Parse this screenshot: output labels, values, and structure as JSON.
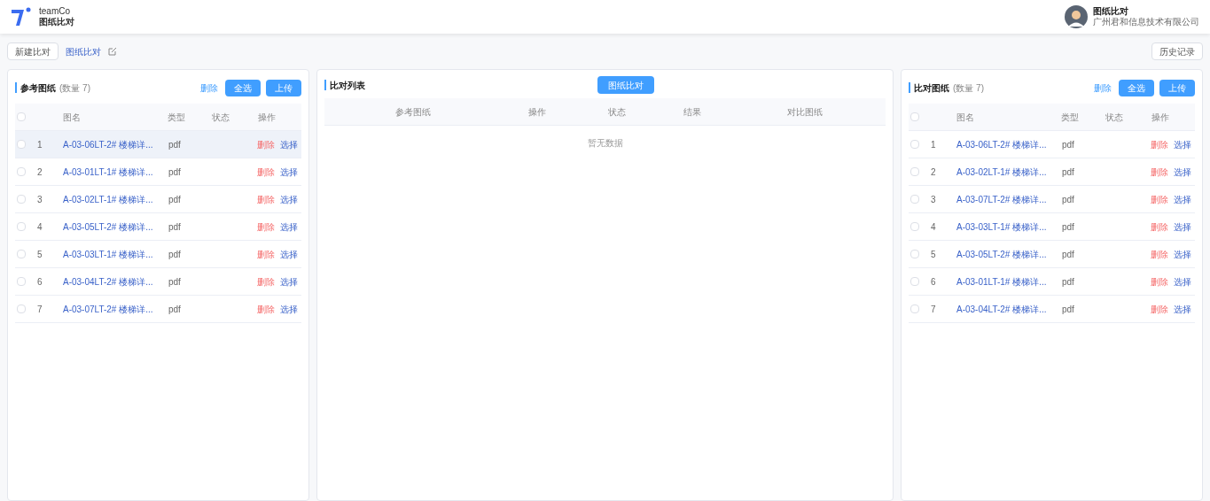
{
  "header": {
    "brand": "teamCo",
    "app_name": "图纸比对",
    "user_name": "图纸比对",
    "company": "广州君和信息技术有限公司"
  },
  "toolbar": {
    "new_button": "新建比对",
    "breadcrumb": "图纸比对",
    "history_button": "历史记录"
  },
  "reference_panel": {
    "title": "参考图纸",
    "count": "(数量 7)",
    "delete_link": "删除",
    "select_all_button": "全选",
    "upload_button": "上传",
    "all_checked": false,
    "columns": [
      "图名",
      "类型",
      "状态",
      "操作"
    ],
    "rows": [
      {
        "index": "1",
        "name": "A-03-06LT-2# 楼梯详...",
        "type": "pdf",
        "checked": false,
        "highlighted": true,
        "delete": "删除",
        "select": "选择"
      },
      {
        "index": "2",
        "name": "A-03-01LT-1# 楼梯详...",
        "type": "pdf",
        "checked": false,
        "highlighted": false,
        "delete": "删除",
        "select": "选择"
      },
      {
        "index": "3",
        "name": "A-03-02LT-1# 楼梯详...",
        "type": "pdf",
        "checked": false,
        "highlighted": false,
        "delete": "删除",
        "select": "选择"
      },
      {
        "index": "4",
        "name": "A-03-05LT-2# 楼梯详...",
        "type": "pdf",
        "checked": false,
        "highlighted": false,
        "delete": "删除",
        "select": "选择"
      },
      {
        "index": "5",
        "name": "A-03-03LT-1# 楼梯详...",
        "type": "pdf",
        "checked": false,
        "highlighted": false,
        "delete": "删除",
        "select": "选择"
      },
      {
        "index": "6",
        "name": "A-03-04LT-2# 楼梯详...",
        "type": "pdf",
        "checked": false,
        "highlighted": false,
        "delete": "删除",
        "select": "选择"
      },
      {
        "index": "7",
        "name": "A-03-07LT-2# 楼梯详...",
        "type": "pdf",
        "checked": false,
        "highlighted": false,
        "delete": "删除",
        "select": "选择"
      }
    ]
  },
  "compare_panel": {
    "title": "比对列表",
    "compare_button": "图纸比对",
    "columns": [
      "参考图纸",
      "操作",
      "状态",
      "结果",
      "对比图纸"
    ],
    "empty_text": "暂无数据"
  },
  "target_panel": {
    "title": "比对图纸",
    "count": "(数量 7)",
    "delete_link": "删除",
    "select_all_button": "全选",
    "upload_button": "上传",
    "all_checked": false,
    "columns": [
      "图名",
      "类型",
      "状态",
      "操作"
    ],
    "rows": [
      {
        "index": "1",
        "name": "A-03-06LT-2# 楼梯详...",
        "type": "pdf",
        "checked": false,
        "highlighted": false,
        "delete": "删除",
        "select": "选择"
      },
      {
        "index": "2",
        "name": "A-03-02LT-1# 楼梯详...",
        "type": "pdf",
        "checked": false,
        "highlighted": false,
        "delete": "删除",
        "select": "选择"
      },
      {
        "index": "3",
        "name": "A-03-07LT-2# 楼梯详...",
        "type": "pdf",
        "checked": false,
        "highlighted": false,
        "delete": "删除",
        "select": "选择"
      },
      {
        "index": "4",
        "name": "A-03-03LT-1# 楼梯详...",
        "type": "pdf",
        "checked": false,
        "highlighted": false,
        "delete": "删除",
        "select": "选择"
      },
      {
        "index": "5",
        "name": "A-03-05LT-2# 楼梯详...",
        "type": "pdf",
        "checked": false,
        "highlighted": false,
        "delete": "删除",
        "select": "选择"
      },
      {
        "index": "6",
        "name": "A-03-01LT-1# 楼梯详...",
        "type": "pdf",
        "checked": false,
        "highlighted": false,
        "delete": "删除",
        "select": "选择"
      },
      {
        "index": "7",
        "name": "A-03-04LT-2# 楼梯详...",
        "type": "pdf",
        "checked": false,
        "highlighted": false,
        "delete": "删除",
        "select": "选择"
      }
    ]
  }
}
